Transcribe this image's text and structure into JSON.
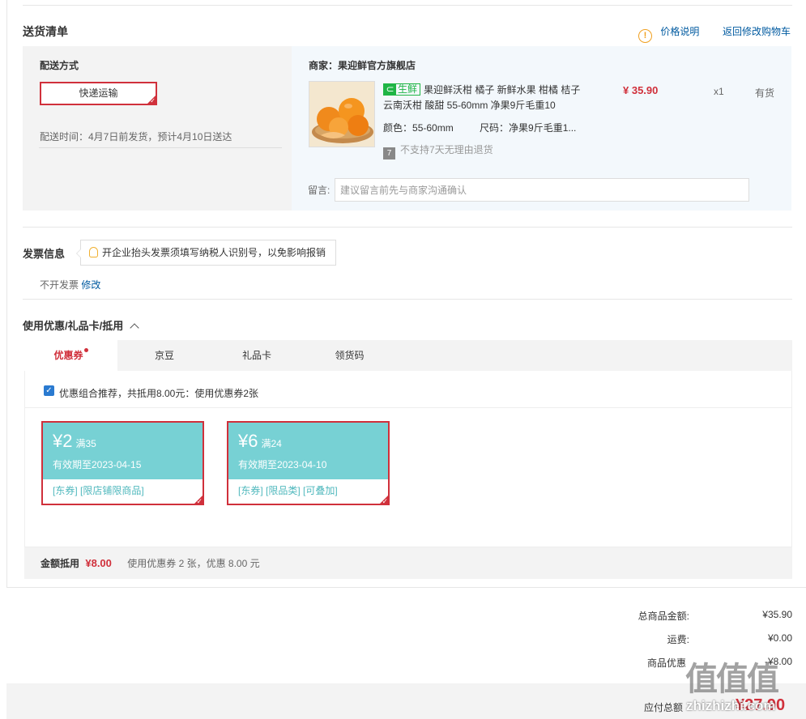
{
  "delivery": {
    "section_title": "送货清单",
    "price_note_label": "价格说明",
    "back_to_cart_label": "返回修改购物车",
    "method_label": "配送方式",
    "method_value": "快递运输",
    "delivery_time": "配送时间：4月7日前发货，预计4月10日送达"
  },
  "merchant": {
    "label": "商家：果迎鲜官方旗舰店"
  },
  "product": {
    "badge": "生鲜",
    "name": "果迎鲜沃柑 橘子 新鲜水果 柑橘 桔子 云南沃柑 酸甜 55-60mm 净果9斤毛重10",
    "price": "¥ 35.90",
    "qty": "x1",
    "stock": "有货",
    "color_label": "颜色：",
    "color_value": "55-60mm",
    "size_label": "尺码：",
    "size_value": "净果9斤毛重1...",
    "return_icon_text": "7",
    "return_note": "不支持7天无理由退货"
  },
  "remark": {
    "label": "留言:",
    "placeholder": "建议留言前先与商家沟通确认"
  },
  "invoice": {
    "title": "发票信息",
    "tip": "开企业抬头发票须填写纳税人识别号，以免影响报销",
    "value": "不开发票",
    "edit_label": "修改"
  },
  "coupons": {
    "title": "使用优惠/礼品卡/抵用",
    "tabs": [
      {
        "label": "优惠券"
      },
      {
        "label": "京豆"
      },
      {
        "label": "礼品卡"
      },
      {
        "label": "领货码"
      }
    ],
    "recommend_text": "优惠组合推荐，共抵用8.00元：使用优惠券2张",
    "items": [
      {
        "amount": "¥2",
        "condition": "满35",
        "valid": "有效期至2023-04-15",
        "tags": "[东券] [限店铺限商品]"
      },
      {
        "amount": "¥6",
        "condition": "满24",
        "valid": "有效期至2023-04-10",
        "tags": "[东券] [限品类] [可叠加]"
      }
    ],
    "deduct_label": "金额抵用",
    "deduct_amount": "¥8.00",
    "deduct_detail": "使用优惠券 2 张，优惠 8.00 元"
  },
  "summary": {
    "goods_total_label": "总商品金额:",
    "goods_total_value": "¥35.90",
    "shipping_label": "运费:",
    "shipping_value": "¥0.00",
    "discount_label": "商品优惠",
    "discount_value": "-¥8.00",
    "payable_label": "应付总额",
    "payable_value": "¥27.90"
  },
  "watermark": {
    "text": "zhizhizhi.com",
    "logo": "值值值"
  },
  "colors": {
    "accent_red": "#d0303b",
    "link_blue": "#005aa0",
    "coupon_teal": "#77d1d4",
    "fresh_green": "#1fb545"
  }
}
